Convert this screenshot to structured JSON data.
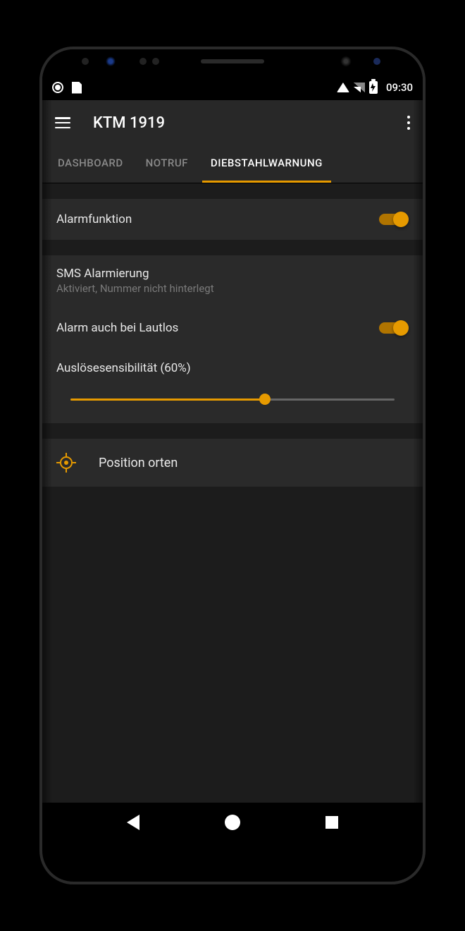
{
  "status_bar": {
    "clock": "09:30"
  },
  "app_bar": {
    "title": "KTM 1919"
  },
  "tabs": [
    {
      "label": "DASHBOARD",
      "active": false
    },
    {
      "label": "NOTRUF",
      "active": false
    },
    {
      "label": "DIEBSTAHLWARNUNG",
      "active": true
    }
  ],
  "alarm_func": {
    "label": "Alarmfunktion",
    "on": true
  },
  "sms_alarm": {
    "title": "SMS Alarmierung",
    "subtitle": "Aktiviert, Nummer nicht hinterlegt"
  },
  "silent_alarm": {
    "label": "Alarm auch bei Lautlos",
    "on": true
  },
  "sensitivity": {
    "label": "Auslösesensibilität (60%)",
    "percent": 60
  },
  "locate": {
    "label": "Position orten"
  },
  "colors": {
    "accent": "#e69a00"
  }
}
